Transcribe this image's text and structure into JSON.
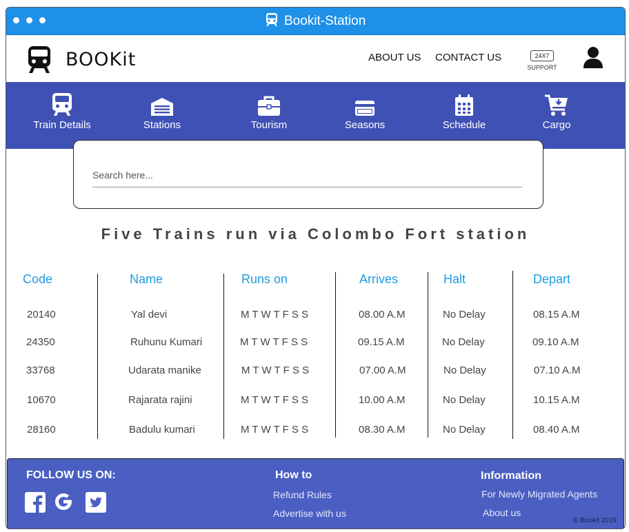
{
  "window": {
    "title": "Bookit-Station"
  },
  "header": {
    "logo_text": "BOOKit",
    "nav": {
      "about": "ABOUT US",
      "contact": "CONTACT US"
    },
    "support": {
      "badge": "24X7",
      "label": "SUPPORT"
    }
  },
  "menu": [
    {
      "label": "Train Details",
      "icon": "train-icon"
    },
    {
      "label": "Stations",
      "icon": "station-icon"
    },
    {
      "label": "Tourism",
      "icon": "briefcase-icon"
    },
    {
      "label": "Seasons",
      "icon": "card-icon"
    },
    {
      "label": "Schedule",
      "icon": "calendar-icon"
    },
    {
      "label": "Cargo",
      "icon": "cart-icon"
    }
  ],
  "search": {
    "placeholder": "Search here..."
  },
  "heading": "Five Trains run via Colombo Fort station",
  "table": {
    "headers": [
      "Code",
      "Name",
      "Runs on",
      "Arrives",
      "Halt",
      "Depart"
    ],
    "rows": [
      [
        "20140",
        "Yal devi",
        "M T W T F S S",
        "08.00 A.M",
        "No Delay",
        "08.15 A.M"
      ],
      [
        "24350",
        "Ruhunu Kumari",
        "M T W T F S S",
        "09.15 A.M",
        "No Delay",
        "09.10 A.M"
      ],
      [
        "33768",
        "Udarata manike",
        "M T W T F S S",
        "07.00 A.M",
        "No Delay",
        "07.10 A.M"
      ],
      [
        "10670",
        "Rajarata rajini",
        "M T W T F S S",
        "10.00 A.M",
        "No Delay",
        "10.15 A.M"
      ],
      [
        "28160",
        "Badulu kumari",
        "M T W T F S S",
        "08.30 A.M",
        "No Delay",
        "08.40 A.M"
      ]
    ]
  },
  "footer": {
    "follow": "FOLLOW US ON:",
    "howto": {
      "title": "How to",
      "links": [
        "Refund Rules",
        "Advertise with us"
      ]
    },
    "info": {
      "title": "Information",
      "links": [
        "For Newly Migrated Agents",
        "About us"
      ]
    },
    "copyright": "© Bookit 2019"
  },
  "colors": {
    "titlebar": "#1e90e8",
    "menubar": "#3f51b5",
    "footer": "#4a5fc1",
    "header_text": "#1e9be0"
  }
}
